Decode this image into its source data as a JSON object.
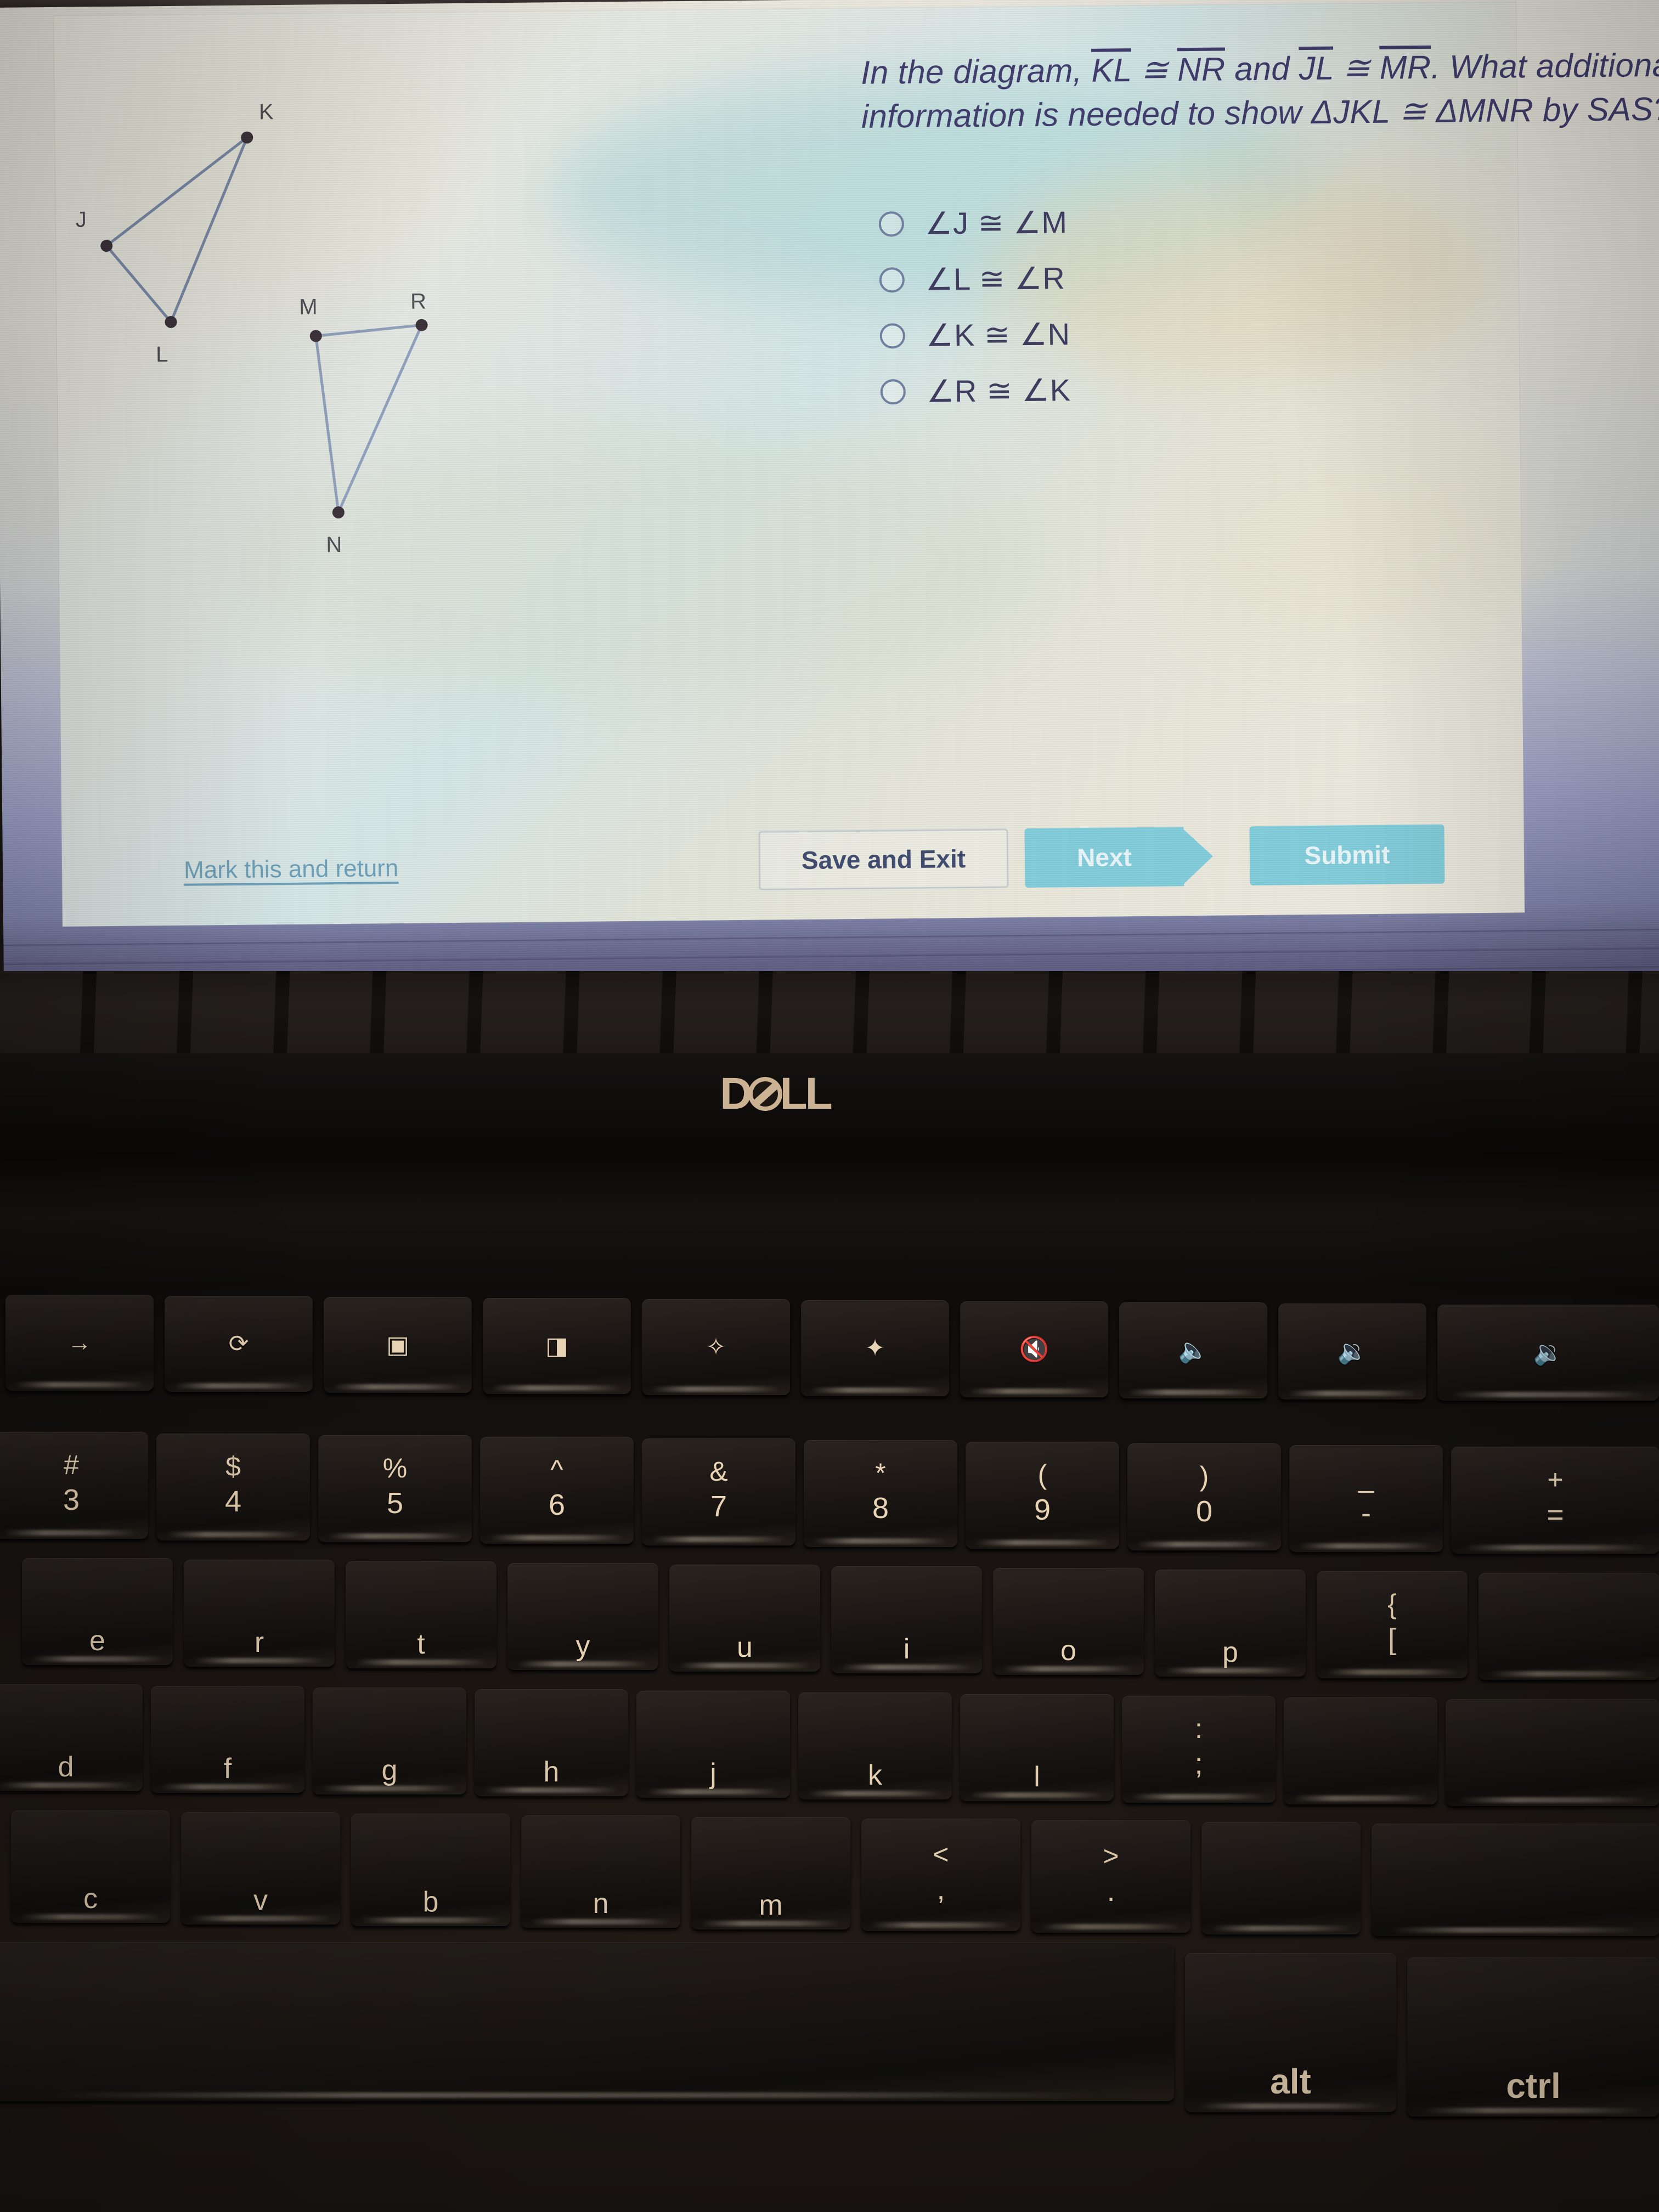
{
  "question": {
    "line1_pre": "In the diagram, ",
    "seg_kl": "KL",
    "cong1": " ≅ ",
    "seg_nr": "NR",
    "and": " and ",
    "seg_jl": "JL",
    "cong2": " ≅ ",
    "seg_mr": "MR",
    "line1_post": ". What additional",
    "line2_pre": "information is needed to show ",
    "tri1": "ΔJKL",
    "cong3": " ≅ ",
    "tri2": "ΔMNR",
    "line2_post": " by SAS?"
  },
  "options": [
    {
      "id": "opt-a",
      "label": "∠J ≅ ∠M",
      "selected": false
    },
    {
      "id": "opt-b",
      "label": "∠L ≅ ∠R",
      "selected": false
    },
    {
      "id": "opt-c",
      "label": "∠K ≅ ∠N",
      "selected": false
    },
    {
      "id": "opt-d",
      "label": "∠R ≅ ∠K",
      "selected": false
    }
  ],
  "diagram": {
    "vertex_labels": [
      "K",
      "J",
      "L",
      "M",
      "R",
      "N"
    ],
    "triangle_1": {
      "name": "JKL",
      "vertices": [
        "J",
        "K",
        "L"
      ]
    },
    "triangle_2": {
      "name": "MNR",
      "vertices": [
        "M",
        "N",
        "R"
      ]
    }
  },
  "footer": {
    "mark_link": "Mark this and return",
    "save_button": "Save and Exit",
    "next_button": "Next",
    "submit_button": "Submit"
  },
  "laptop": {
    "brand": "DELL",
    "brand_d": "D",
    "brand_ll": "LL"
  },
  "keyboard": {
    "function_row": [
      {
        "name": "forward-arrow-key",
        "glyph": "→"
      },
      {
        "name": "refresh-key",
        "glyph": "⟳"
      },
      {
        "name": "fullscreen-key",
        "glyph": "▣"
      },
      {
        "name": "window-switcher-key",
        "glyph": "◨"
      },
      {
        "name": "brightness-down-key",
        "glyph": "✧"
      },
      {
        "name": "brightness-up-key",
        "glyph": "✦"
      },
      {
        "name": "mute-key",
        "glyph": "🔇"
      },
      {
        "name": "volume-down-key",
        "glyph": "🔈"
      },
      {
        "name": "volume-up-key",
        "glyph": "🔉"
      }
    ],
    "number_row": [
      {
        "name": "key-3",
        "upper": "#",
        "lower": "3"
      },
      {
        "name": "key-4",
        "upper": "$",
        "lower": "4"
      },
      {
        "name": "key-5",
        "upper": "%",
        "lower": "5"
      },
      {
        "name": "key-6",
        "upper": "^",
        "lower": "6"
      },
      {
        "name": "key-7",
        "upper": "&",
        "lower": "7"
      },
      {
        "name": "key-8",
        "upper": "*",
        "lower": "8"
      },
      {
        "name": "key-9",
        "upper": "(",
        "lower": "9"
      },
      {
        "name": "key-0",
        "upper": ")",
        "lower": "0"
      },
      {
        "name": "key-minus",
        "upper": "_",
        "lower": "-"
      },
      {
        "name": "key-equals",
        "upper": "+",
        "lower": "="
      }
    ],
    "top_letter_row": [
      {
        "name": "key-e",
        "label": "e"
      },
      {
        "name": "key-r",
        "label": "r"
      },
      {
        "name": "key-t",
        "label": "t"
      },
      {
        "name": "key-y",
        "label": "y"
      },
      {
        "name": "key-u",
        "label": "u"
      },
      {
        "name": "key-i",
        "label": "i"
      },
      {
        "name": "key-o",
        "label": "o"
      },
      {
        "name": "key-p",
        "label": "p"
      },
      {
        "name": "key-bracket-left",
        "upper": "{",
        "lower": "["
      }
    ],
    "home_row": [
      {
        "name": "key-d",
        "label": "d"
      },
      {
        "name": "key-f",
        "label": "f"
      },
      {
        "name": "key-g",
        "label": "g"
      },
      {
        "name": "key-h",
        "label": "h"
      },
      {
        "name": "key-j",
        "label": "j"
      },
      {
        "name": "key-k",
        "label": "k"
      },
      {
        "name": "key-l",
        "label": "l"
      },
      {
        "name": "key-semicolon",
        "upper": ":",
        "lower": ";"
      }
    ],
    "bottom_row": [
      {
        "name": "key-c",
        "label": "c"
      },
      {
        "name": "key-v",
        "label": "v"
      },
      {
        "name": "key-b",
        "label": "b"
      },
      {
        "name": "key-n",
        "label": "n"
      },
      {
        "name": "key-m",
        "label": "m"
      },
      {
        "name": "key-comma",
        "upper": "<",
        "lower": ","
      },
      {
        "name": "key-period",
        "upper": ">",
        "lower": "."
      }
    ],
    "modifier_row": [
      {
        "name": "key-alt",
        "label": "alt"
      },
      {
        "name": "key-ctrl",
        "label": "ctrl"
      }
    ]
  },
  "colors": {
    "accent_teal": "#81ccda",
    "question_text": "#3e3a6b",
    "option_text": "#3e3a5e",
    "link_blue": "#6c9fb8",
    "dell_gold": "#cbb292",
    "key_text": "#e8d3b4"
  }
}
